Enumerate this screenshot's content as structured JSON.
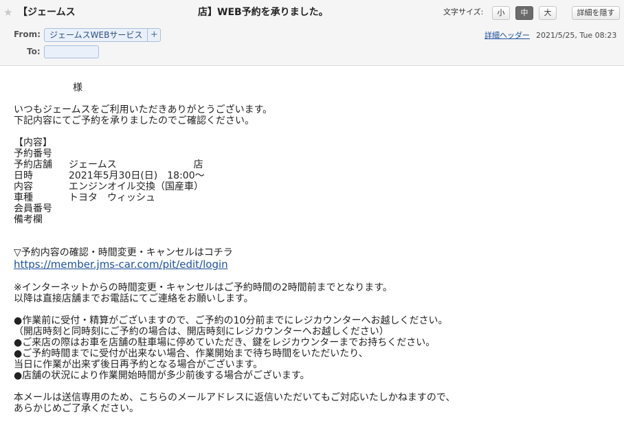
{
  "header": {
    "subject_left": "【ジェームス",
    "subject_right": "店】WEB予約を承りました。",
    "font_size_label": "文字サイズ:",
    "font_size_options": [
      "小",
      "中",
      "大"
    ],
    "font_size_selected": "中",
    "detail_hide_label": "詳細を隠す",
    "from_label": "From:",
    "from_name": "ジェームスWEBサービス",
    "to_label": "To:",
    "detail_header_link": "詳細ヘッダー",
    "date": "2021/5/25, Tue 08:23"
  },
  "icons": {
    "star": "star-icon",
    "add_contact": "plus-icon"
  },
  "colors": {
    "link": "#1a4f9c",
    "chip_bg": "#e9f0fa",
    "selected_size_bg": "#6b6b6b"
  },
  "body": {
    "salutation": "様",
    "greeting": [
      "いつもジェームスをご利用いただきありがとうございます。",
      "下記内容にてご予約を承りましたのでご確認ください。"
    ],
    "section_title": "【内容】",
    "details": [
      {
        "key": "予約番号",
        "value": ""
      },
      {
        "key": "予約店舗",
        "value": "ジェームス　　　　　　　　店"
      },
      {
        "key": "日時",
        "value": "2021年5月30日(日)　18:00〜"
      },
      {
        "key": "内容",
        "value": "エンジンオイル交換（国産車）"
      },
      {
        "key": "車種",
        "value": "トヨタ　ウィッシュ"
      },
      {
        "key": "会員番号",
        "value": ""
      },
      {
        "key": "備考欄",
        "value": ""
      }
    ],
    "confirm_heading": "▽予約内容の確認・時間変更・キャンセルはコチラ",
    "confirm_url": "https://member.jms-car.com/pit/edit/login",
    "notice": [
      "※インターネットからの時間変更・キャンセルはご予約時間の2時間前までとなります。",
      "以降は直接店舗までお電話にてご連絡をお願いします。"
    ],
    "bullets": [
      "●作業前に受付・精算がございますので、ご予約の10分前までにレジカウンターへお越しください。",
      "（開店時刻と同時刻にご予約の場合は、開店時刻にレジカウンターへお越しください）",
      "●ご来店の際はお車を店舗の駐車場に停めていただき、鍵をレジカウンターまでお持ちください。",
      "●ご予約時間までに受付が出来ない場合、作業開始まで待ち時間をいただいたり、",
      "当日に作業が出来ず後日再予約となる場合がございます。",
      "●店舗の状況により作業開始時間が多少前後する場合がございます。"
    ],
    "footer": [
      "本メールは送信専用のため、こちらのメールアドレスに返信いただいてもご対応いたしかねますので、",
      "あらかじめご了承ください。"
    ]
  }
}
